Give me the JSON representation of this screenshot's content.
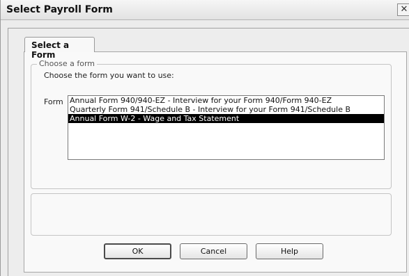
{
  "dialog": {
    "title": "Select Payroll Form",
    "close_glyph": "✕",
    "tab_label": "Select a Form"
  },
  "group": {
    "legend": "Choose a form",
    "instruction": "Choose the form you want to use:",
    "form_label": "Form"
  },
  "forms": [
    {
      "label": "Annual Form 940/940-EZ - Interview for your Form 940/Form 940-EZ",
      "selected": false
    },
    {
      "label": "Quarterly Form 941/Schedule B - Interview for your Form 941/Schedule B",
      "selected": false
    },
    {
      "label": "Annual Form W-2 - Wage and Tax Statement",
      "selected": true
    }
  ],
  "buttons": {
    "ok": "OK",
    "cancel": "Cancel",
    "help": "Help"
  }
}
